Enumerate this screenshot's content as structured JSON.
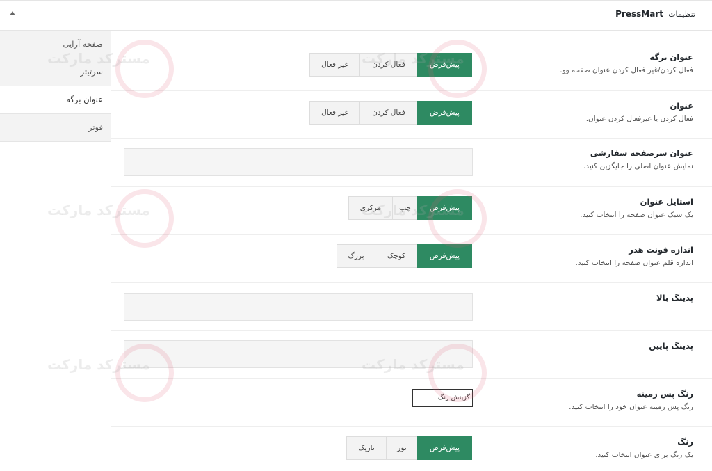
{
  "header": {
    "title": "PressMart",
    "subtitle": "تنظیمات",
    "collapse_icon": "triangle-up-icon"
  },
  "sidebar": {
    "items": [
      {
        "label": "صفحه آرایی",
        "active": false
      },
      {
        "label": "سرتیتر",
        "active": false
      },
      {
        "label": "عنوان برگه",
        "active": true
      },
      {
        "label": "فوتر",
        "active": false
      }
    ]
  },
  "settings": {
    "page_title": {
      "title": "عنوان برگه",
      "desc": "فعال کردن/غیر فعال کردن عنوان صفحه وو.",
      "options": [
        "پیش‌فرض",
        "فعال کردن",
        "غیر فعال"
      ],
      "selected": "پیش‌فرض"
    },
    "title": {
      "title": "عنوان",
      "desc": "فعال کردن یا غیرفعال کردن عنوان.",
      "options": [
        "پیش‌فرض",
        "فعال کردن",
        "غیر فعال"
      ],
      "selected": "پیش‌فرض"
    },
    "custom_header_title": {
      "title": "عنوان سرصفحه سفارشی",
      "desc": "نمایش عنوان اصلی را جایگزین کنید.",
      "value": ""
    },
    "title_style": {
      "title": "استایل عنوان",
      "desc": "یک سبک عنوان صفحه را انتخاب کنید.",
      "options": [
        "پیش‌فرض",
        "چپ",
        "مرکزی"
      ],
      "selected": "پیش‌فرض"
    },
    "header_font_size": {
      "title": "اندازه فونت هدر",
      "desc": "اندازه قلم عنوان صفحه را انتخاب کنید.",
      "options": [
        "پیش‌فرض",
        "کوچک",
        "بزرگ"
      ],
      "selected": "پیش‌فرض"
    },
    "padding_top": {
      "title": "پدینگ بالا",
      "value": ""
    },
    "padding_bottom": {
      "title": "پدینگ پایین",
      "value": ""
    },
    "background_color": {
      "title": "رنگ پس زمینه",
      "desc": "رنگ پس زمینه عنوان خود را انتخاب کنید.",
      "button_label": "گزینش رنگ"
    },
    "color": {
      "title": "رنگ",
      "desc": "یک رنگ برای عنوان انتخاب کنید.",
      "options": [
        "پیش‌فرض",
        "نور",
        "تاریک"
      ],
      "selected": "پیش‌فرض"
    }
  },
  "watermark": {
    "text": "مسترکد مارکت"
  },
  "colors": {
    "accent": "#2e8a62",
    "button_bg": "#f3f3f3",
    "border": "#e5e5e5"
  }
}
